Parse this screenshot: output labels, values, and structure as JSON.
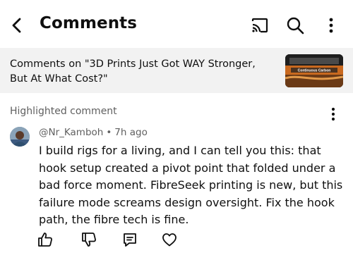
{
  "header": {
    "title": "Comments",
    "icons": [
      "back-arrow-icon",
      "cast-icon",
      "search-icon",
      "more-vert-icon"
    ]
  },
  "video": {
    "comments_on_label": "Comments on \"3D Prints Just Got WAY Stronger, But At What Cost?\"",
    "thumbnail_text": "Continuous Carbon"
  },
  "highlighted": {
    "label": "Highlighted comment"
  },
  "comment": {
    "author": "@Nr_Kamboh",
    "separator": "•",
    "time": "7h ago",
    "text": "I build rigs for a living, and I can tell you this: that hook setup created a pivot point that folded under a bad force moment. FibreSeek printing is new, but this failure mode screams design oversight. Fix the hook path, the fibre tech is fine."
  },
  "actions": [
    "thumbs-up-icon",
    "thumbs-down-icon",
    "reply-icon",
    "heart-icon"
  ],
  "colors": {
    "text": "#0f0f0f",
    "secondary": "#606060",
    "bar_bg": "#f2f2f2"
  }
}
